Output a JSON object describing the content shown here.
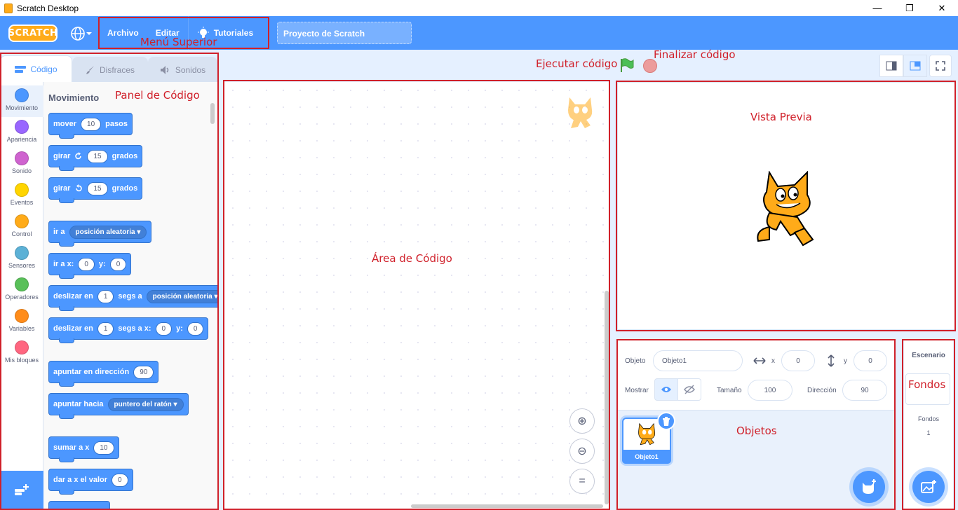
{
  "window": {
    "title": "Scratch Desktop",
    "controls": [
      "—",
      "❐",
      "✕"
    ]
  },
  "menubar": {
    "logo_text": "SCRATCH",
    "items": [
      "Archivo",
      "Editar",
      "Tutoriales"
    ],
    "project_title": "Proyecto de Scratch"
  },
  "tabs": [
    "Código",
    "Disfraces",
    "Sonidos"
  ],
  "categories": [
    {
      "label": "Movimiento",
      "color": "#4c97ff"
    },
    {
      "label": "Apariencia",
      "color": "#9966ff"
    },
    {
      "label": "Sonido",
      "color": "#cf63cf"
    },
    {
      "label": "Eventos",
      "color": "#ffd500"
    },
    {
      "label": "Control",
      "color": "#ffab19"
    },
    {
      "label": "Sensores",
      "color": "#5cb1d6"
    },
    {
      "label": "Operadores",
      "color": "#59c059"
    },
    {
      "label": "Variables",
      "color": "#ff8c1a"
    },
    {
      "label": "Mis bloques",
      "color": "#ff6680"
    }
  ],
  "palette": {
    "heading": "Movimiento",
    "blocks": {
      "move": {
        "pre": "mover",
        "v": "10",
        "post": "pasos"
      },
      "turn_right": {
        "pre": "girar",
        "v": "15",
        "post": "grados"
      },
      "turn_left": {
        "pre": "girar",
        "v": "15",
        "post": "grados"
      },
      "goto": {
        "pre": "ir a",
        "drop": "posición aleatoria"
      },
      "goto_xy": {
        "pre": "ir a x:",
        "x": "0",
        "mid": "y:",
        "y": "0"
      },
      "glide": {
        "pre": "deslizar en",
        "v": "1",
        "mid": "segs a",
        "drop": "posición aleatoria"
      },
      "glide_xy": {
        "pre": "deslizar en",
        "v": "1",
        "mid": "segs a x:",
        "x": "0",
        "mid2": "y:",
        "y": "0"
      },
      "point_dir": {
        "pre": "apuntar en dirección",
        "v": "90"
      },
      "point_towards": {
        "pre": "apuntar hacia",
        "drop": "puntero del ratón"
      },
      "change_x": {
        "pre": "sumar a x",
        "v": "10"
      },
      "set_x": {
        "pre": "dar a x el valor",
        "v": "0"
      }
    }
  },
  "sprite_info": {
    "sprite_label": "Objeto",
    "sprite_name": "Objeto1",
    "x_label": "x",
    "x": "0",
    "y_label": "y",
    "y": "0",
    "show_label": "Mostrar",
    "size_label": "Tamaño",
    "size": "100",
    "direction_label": "Dirección",
    "direction": "90"
  },
  "sprites": [
    {
      "name": "Objeto1"
    }
  ],
  "stage_pane": {
    "title": "Escenario",
    "backdrops_label": "Fondos",
    "backdrops_count": "1"
  },
  "annotations": {
    "menu": "Menú Superior",
    "code_panel": "Panel de Código",
    "run": "Ejecutar código",
    "stop": "Finalizar código",
    "code_area": "Área de Código",
    "preview": "Vista Previa",
    "sprites": "Objetos",
    "backdrops": "Fondos"
  },
  "colors": {
    "accent": "#4c97ff",
    "annotation": "#d0202a",
    "cat_orange": "#ffab19"
  }
}
